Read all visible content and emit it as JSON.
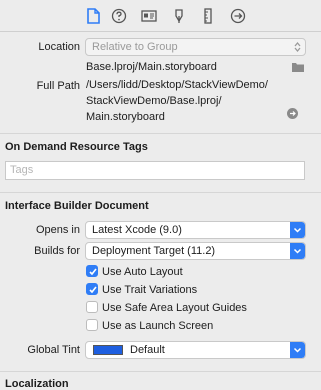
{
  "toolbar": {
    "icons": [
      "file-inspector-icon",
      "quick-help-icon",
      "identity-icon",
      "attributes-icon",
      "size-icon",
      "connections-icon"
    ]
  },
  "location": {
    "label": "Location",
    "value": "Relative to Group",
    "filename": "Base.lproj/Main.storyboard"
  },
  "full_path": {
    "label": "Full Path",
    "lines": [
      "/Users/lidd/Desktop/StackViewDemo/",
      "StackViewDemo/Base.lproj/",
      "Main.storyboard"
    ]
  },
  "on_demand": {
    "title": "On Demand Resource Tags",
    "tags_placeholder": "Tags"
  },
  "ib_document": {
    "title": "Interface Builder Document",
    "opens_in_label": "Opens in",
    "opens_in_value": "Latest Xcode (9.0)",
    "builds_for_label": "Builds for",
    "builds_for_value": "Deployment Target (11.2)",
    "checkboxes": [
      {
        "label": "Use Auto Layout",
        "checked": true
      },
      {
        "label": "Use Trait Variations",
        "checked": true
      },
      {
        "label": "Use Safe Area Layout Guides",
        "checked": false
      },
      {
        "label": "Use as Launch Screen",
        "checked": false
      }
    ],
    "global_tint_label": "Global Tint",
    "global_tint_value": "Default",
    "tint_color": "#1e5fe0"
  },
  "localization": {
    "title": "Localization"
  }
}
